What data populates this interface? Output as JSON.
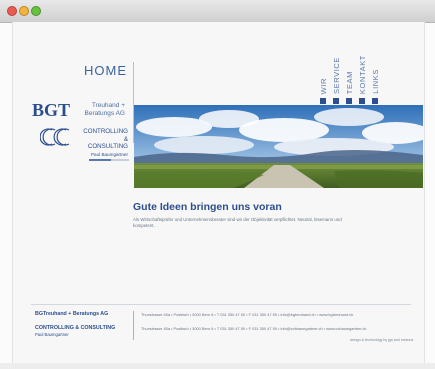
{
  "window": {
    "traffic_lights": [
      "close",
      "minimize",
      "zoom"
    ]
  },
  "header": {
    "home_label": "HOME"
  },
  "nav": {
    "items": [
      {
        "label": "WIR"
      },
      {
        "label": "SERVICE"
      },
      {
        "label": "TEAM"
      },
      {
        "label": "KONTAKT"
      },
      {
        "label": "LINKS"
      }
    ]
  },
  "brand": {
    "bgt_logo": "BGT",
    "bgt_line1": "Treuhand +",
    "bgt_line2": "Beratungs AG",
    "cc_line1": "CONTROLLING &",
    "cc_line2": "CONSULTING",
    "cc_line3": "Paul Baumgartner"
  },
  "colors": {
    "accent": "#2c4e8d",
    "nav_text": "#5a78ab",
    "body_text": "#6a7586"
  },
  "content": {
    "headline": "Gute Ideen bringen uns voran",
    "intro": "Als Wirtschaftsprüfer und Unternehmensberater sind wir der Objektivität verpflichtet. Neutral, lösemann und kompetent."
  },
  "footer": {
    "brand1": "BGTreuhand + Beratungs AG",
    "brand2": "CONTROLLING & CONSULTING",
    "brand2_sub": "Paul Baumgartner",
    "address1": "Thunstrasse 45a • Postfach • 3000 Bern 6 • T 031 350 47 50 • F 031 350 47 59 • info@bgtreuhand.ch • www.bgtreuhand.ch",
    "address2": "Thunstrasse 45a • Postfach • 3000 Bern 6 • T 031 350 47 50 • F 031 350 47 59 • info@cctbaumgartner.ch • www.ccbaumgartner.ch",
    "credit": "design & technology by jgs and mesons"
  },
  "scroll_indicator": {
    "progress": 0.55
  }
}
